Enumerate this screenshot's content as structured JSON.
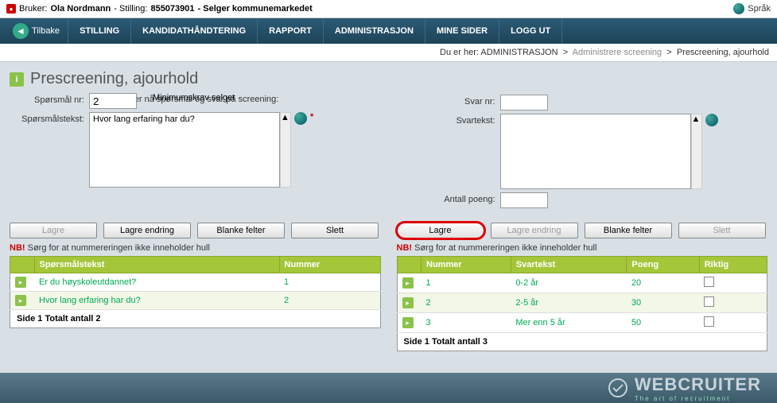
{
  "userbar": {
    "bruker_label": "Bruker:",
    "bruker_name": "Ola Nordmann",
    "stilling_label": " - Stilling:",
    "stilling_id": "855073901",
    "stilling_desc": " - Selger kommunemarkedet",
    "lang": "Språk"
  },
  "nav": {
    "back": "Tilbake",
    "tabs": [
      "STILLING",
      "KANDIDATHÅNDTERING",
      "RAPPORT",
      "ADMINISTRASJON",
      "MINE SIDER",
      "LOGG UT"
    ]
  },
  "breadcrumb": {
    "prefix": "Du er her:",
    "a": "ADMINISTRASJON",
    "b": "Administrere screening",
    "c": "Prescreening, ajourhold"
  },
  "page": {
    "title": "Prescreening, ajourhold",
    "definer1": "Du definerer nå spørsmal og svar på screening:",
    "definer2": "Minimumskrav selger"
  },
  "left": {
    "sporsmal_nr_label": "Spørsmål nr:",
    "sporsmal_nr": "2",
    "sporsmalstekst_label": "Spørsmålstekst:",
    "sporsmalstekst": "Hvor lang erfaring har du?",
    "btn_lagre": "Lagre",
    "btn_lagre_endring": "Lagre endring",
    "btn_blanke": "Blanke felter",
    "btn_slett": "Slett"
  },
  "right": {
    "svar_nr_label": "Svar nr:",
    "svar_nr": "",
    "svartekst_label": "Svartekst:",
    "svartekst": "",
    "antall_poeng_label": "Antall poeng:",
    "antall_poeng": "",
    "btn_lagre": "Lagre",
    "btn_lagre_endring": "Lagre endring",
    "btn_blanke": "Blanke felter",
    "btn_slett": "Slett"
  },
  "nb": {
    "prefix": "NB!",
    "text": "Sørg for at nummereringen ikke inneholder hull"
  },
  "grid_q": {
    "cols": [
      "Spørsmålstekst",
      "Nummer"
    ],
    "rows": [
      {
        "text": "Er du høyskoleutdannet?",
        "num": "1"
      },
      {
        "text": "Hvor lang erfaring har du?",
        "num": "2"
      }
    ],
    "pager": "Side  1   Totalt antall 2"
  },
  "grid_a": {
    "cols": [
      "Nummer",
      "Svartekst",
      "Poeng",
      "Riktig"
    ],
    "rows": [
      {
        "num": "1",
        "text": "0-2 år",
        "poeng": "20"
      },
      {
        "num": "2",
        "text": "2-5 år",
        "poeng": "30"
      },
      {
        "num": "3",
        "text": "Mer enn 5 år",
        "poeng": "50"
      }
    ],
    "pager": "Side  1   Totalt antall 3"
  },
  "footer": {
    "brand": "WEBCRUITER",
    "tag": "The art of recruitment"
  }
}
